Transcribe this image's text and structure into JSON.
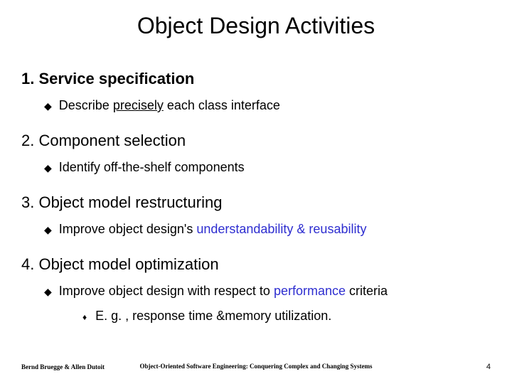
{
  "title": "Object Design Activities",
  "items": [
    {
      "heading": "1. Service specification",
      "heading_bold": true,
      "sub_pre": "Describe ",
      "sub_em": "precisely",
      "sub_post": " each class interface",
      "em_class": "underline",
      "subsub": null
    },
    {
      "heading": "2. Component selection",
      "heading_bold": false,
      "sub_pre": "Identify off-the-shelf components",
      "sub_em": "",
      "sub_post": "",
      "em_class": "",
      "subsub": null
    },
    {
      "heading": "3. Object model restructuring",
      "heading_bold": false,
      "sub_pre": "Improve object design's ",
      "sub_em": "understandability & reusability",
      "sub_post": "",
      "em_class": "blue",
      "subsub": null
    },
    {
      "heading": "4. Object model optimization",
      "heading_bold": false,
      "sub_pre": "Improve object design with respect to ",
      "sub_em": "performance",
      "sub_post": " criteria",
      "em_class": "blue",
      "subsub": "E. g. , response time &memory utilization."
    }
  ],
  "footer": {
    "left": "Bernd Bruegge & Allen Dutoit",
    "center": "Object-Oriented Software Engineering: Conquering Complex and Changing Systems",
    "right": "4"
  }
}
